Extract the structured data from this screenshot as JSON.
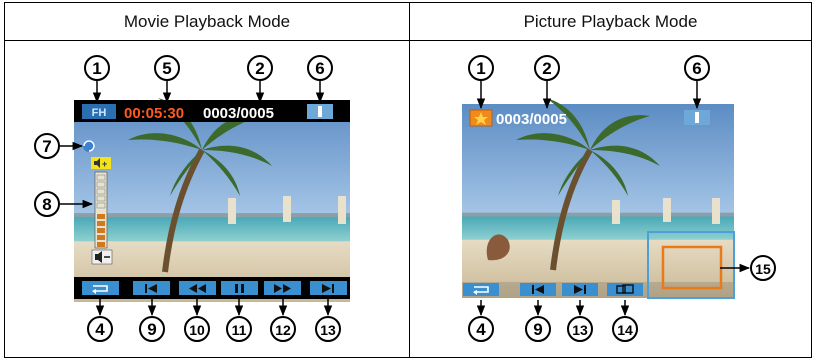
{
  "headers": {
    "movie": "Movie Playback Mode",
    "picture": "Picture Playback Mode"
  },
  "movie": {
    "mode_badge": "FH",
    "time": "00:05:30",
    "counter": "0003/0005",
    "volume_level_fraction": 0.5,
    "callouts": [
      "1",
      "5",
      "2",
      "6",
      "7",
      "8",
      "4",
      "9",
      "10",
      "11",
      "12",
      "13"
    ]
  },
  "picture": {
    "counter": "0003/0005",
    "callouts": [
      "1",
      "2",
      "6",
      "4",
      "9",
      "13",
      "14",
      "15"
    ]
  },
  "colors": {
    "time": "#ff5a1e",
    "osd_button": "#3a8fd0",
    "highlight_box": "#e87a1a",
    "navigator_frame": "#4aa0d8"
  },
  "icons": [
    "mode-icon",
    "battery-icon",
    "volume-icon",
    "return-icon",
    "prev-icon",
    "rewind-icon",
    "pause-icon",
    "fast-forward-icon",
    "next-icon",
    "star-icon",
    "rotate-icon"
  ]
}
